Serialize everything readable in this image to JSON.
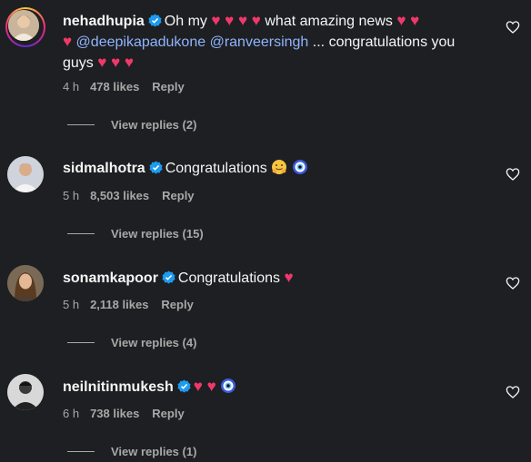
{
  "comments": [
    {
      "username": "nehadhupia",
      "text_prefix": "Oh my",
      "hearts_a": "♥ ♥ ♥ ♥",
      "text_middle": "what amazing news",
      "hearts_b": "♥ ♥",
      "hearts_c": "♥",
      "mention1": "@deepikapadukone",
      "mention2": "@ranveersingh",
      "text_suffix": "... congratulations you guys",
      "hearts_d": "♥ ♥ ♥",
      "time": "4 h",
      "likes": "478 likes",
      "reply": "Reply",
      "view_replies": "View replies (2)"
    },
    {
      "username": "sidmalhotra",
      "text": "Congratulations",
      "emojis": [
        "hugging-face",
        "nazar-amulet"
      ],
      "time": "5 h",
      "likes": "8,503 likes",
      "reply": "Reply",
      "view_replies": "View replies (15)"
    },
    {
      "username": "sonamkapoor",
      "text": "Congratulations",
      "hearts": "♥",
      "time": "5 h",
      "likes": "2,118 likes",
      "reply": "Reply",
      "view_replies": "View replies (4)"
    },
    {
      "username": "neilnitinmukesh",
      "hearts": "♥ ♥",
      "emojis": [
        "nazar-amulet"
      ],
      "time": "6 h",
      "likes": "738 likes",
      "reply": "Reply",
      "view_replies": "View replies (1)"
    }
  ],
  "colors": {
    "background": "#1e1f22",
    "mention": "#8fb4ff",
    "heart": "#f0386b",
    "verified": "#1d9bf0",
    "muted": "#a8a8a8"
  }
}
